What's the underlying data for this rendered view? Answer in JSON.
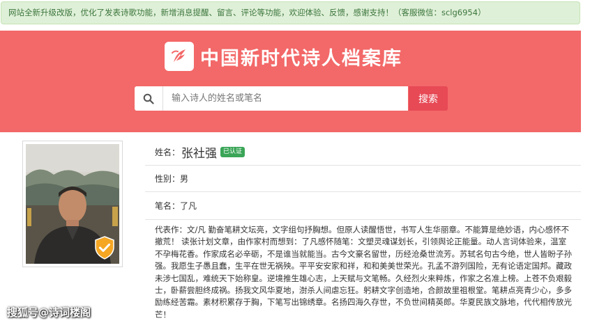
{
  "notice": {
    "text": "网站全新升级改版，优化了发表诗歌功能，新增消息提醒、留言、评论等功能，欢迎体验、反馈，感谢支持！（客服微信：sclg6954）"
  },
  "header": {
    "site_title": "中国新时代诗人档案库",
    "logo_icon": "feather-logo-icon",
    "background_color": "#f36868"
  },
  "search": {
    "placeholder": "输入诗人的姓名或笔名",
    "button_label": "搜索",
    "button_color": "#e74955"
  },
  "profile": {
    "name_label": "姓名：",
    "name": "张社强",
    "verified_badge": "已认证",
    "gender_label": "性别：",
    "gender": "男",
    "pen_name_label": "笔名：",
    "pen_name": "了凡",
    "works_label": "代表作：",
    "works_text": "文/凡 勤奋笔耕文坛亮，文字组句抒胸想。但原人读醒悟世，书写人生华丽章。不能算是绝妙语，内心感怀不撤荒！ 读张计划文章，由作家村而想到：了凡感怀随笔：文塑灵魂谋划长，引领舆论正能量。动人言词体验来，温室不孕梅花香。作家成名必辛砺，不是谁当就能当。古今文豪名留世，历经沧桑世流芳。苏轼名句古今绝，世人皆盼子孙强。我愿生子愚且蠢，生平在世无祸殃。平平安安家和祥，和和美美世荣光。孔孟不游列国险，无有论语定国邦。藏政未涉七国乱，难统天下始称皇。逆境推生雄心志，上天赋与文笔畅。久经烈火来粹炼，作家之名准上榜。上苍不负艰毅士，卧薪尝胆终成祸。扬我文风华夏地，澍杀人间虐忘狂。躬耕文字创造地，合颜故里祖根堂。笔耕点亮青少心，多多励练经苦霜。素材积累存于胸，下笔写出锦绣章。名扬四海久存世，不负世间精英郎。华夏民族文脉地，代代相传放光芒！"
  },
  "watermark": {
    "text": "搜狐号@诗词楼阁"
  }
}
